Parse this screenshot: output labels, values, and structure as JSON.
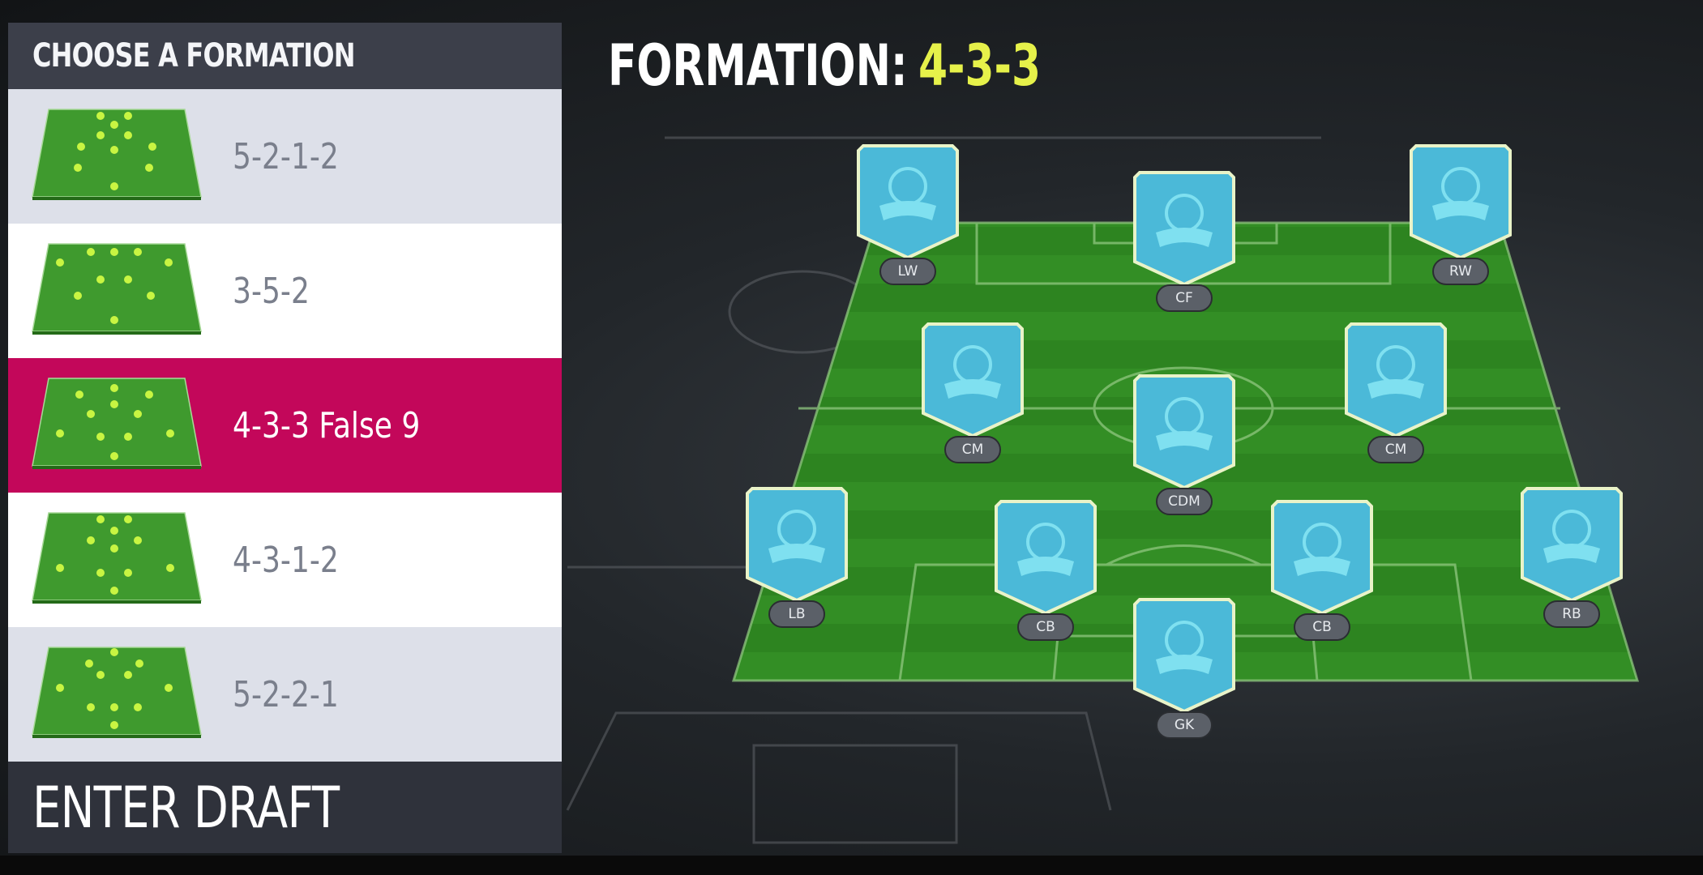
{
  "panel": {
    "title": "CHOOSE A FORMATION",
    "formations": [
      {
        "label": "5-2-1-2",
        "state": "default"
      },
      {
        "label": "3-5-2",
        "state": "default"
      },
      {
        "label": "4-3-3 False 9",
        "state": "selected"
      },
      {
        "label": "4-3-1-2",
        "state": "default"
      },
      {
        "label": "5-2-2-1",
        "state": "default"
      }
    ],
    "enter_button": "ENTER DRAFT"
  },
  "formation_title": {
    "label": "FORMATION:",
    "value": "4-3-3"
  },
  "positions": {
    "lw": "LW",
    "cf": "CF",
    "rw": "RW",
    "cm_left": "CM",
    "cdm": "CDM",
    "cm_right": "CM",
    "lb": "LB",
    "cb_left": "CB",
    "cb_right": "CB",
    "rb": "RB",
    "gk": "GK"
  },
  "colors": {
    "selected": "#c3075a",
    "accent": "#e6f14a",
    "card": "#49b8d6",
    "pitch": "#2f8a22"
  }
}
